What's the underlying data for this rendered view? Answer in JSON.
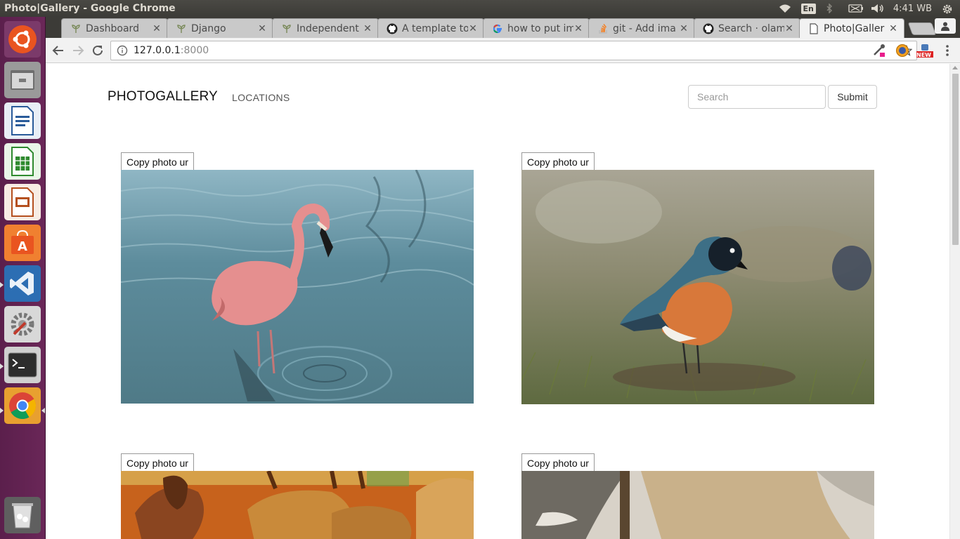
{
  "window": {
    "title": "Photo|Gallery - Google Chrome",
    "time": "4:41 WB",
    "language": "En"
  },
  "tabs": [
    {
      "label": "Dashboard",
      "icon": "leaf-icon"
    },
    {
      "label": "Django",
      "icon": "leaf-icon"
    },
    {
      "label": "Independent",
      "icon": "leaf-icon"
    },
    {
      "label": "A template to",
      "icon": "github-icon"
    },
    {
      "label": "how to put im",
      "icon": "google-icon"
    },
    {
      "label": "git - Add ima",
      "icon": "stackoverflow-icon"
    },
    {
      "label": "Search · olam",
      "icon": "github-icon"
    },
    {
      "label": "Photo|Galler",
      "icon": "page-icon",
      "active": true
    }
  ],
  "address": {
    "host": "127.0.0.1",
    "port": ":8000"
  },
  "extensions": {
    "new_badge": "NEW"
  },
  "site": {
    "brand": "PHOTOGALLERY",
    "nav_locations": "LOCATIONS",
    "search_placeholder": "Search",
    "submit_label": "Submit"
  },
  "photos": [
    {
      "copy_label": "Copy photo ur",
      "subject": "flamingo"
    },
    {
      "copy_label": "Copy photo ur",
      "subject": "starling"
    },
    {
      "copy_label": "Copy photo ur",
      "subject": "elephants"
    },
    {
      "copy_label": "Copy photo ur",
      "subject": "sailboat"
    }
  ],
  "colors": {
    "launcher": "#5b1f4c",
    "panel": "#3c3b37"
  }
}
